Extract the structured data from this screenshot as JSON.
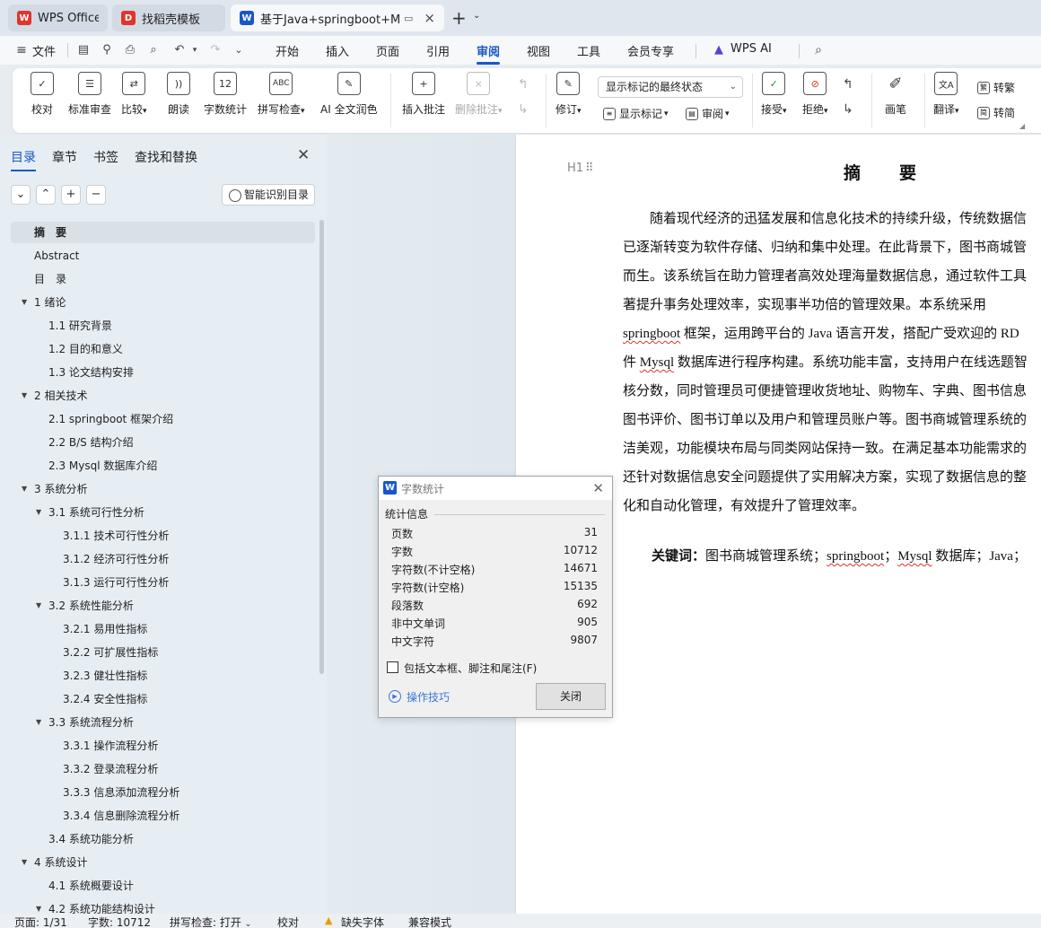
{
  "tabs": [
    {
      "label": "WPS Office",
      "icon": "wps-logo-icon"
    },
    {
      "label": "找稻壳模板",
      "icon": "docer-icon"
    },
    {
      "label": "基于Java+springboot+MyS",
      "icon": "word-doc-icon"
    }
  ],
  "menu": {
    "file": "文件",
    "items": [
      "开始",
      "插入",
      "页面",
      "引用",
      "审阅",
      "视图",
      "工具",
      "会员专享"
    ],
    "selected": "审阅",
    "wps_ai": "WPS AI"
  },
  "ribbon": {
    "proofread": "校对",
    "std_review": "标准审查",
    "compare": "比较",
    "read_aloud": "朗读",
    "word_count": "字数统计",
    "spell_check": "拼写检查",
    "ai_polish": "AI 全文润色",
    "insert_comment": "插入批注",
    "delete_comment": "删除批注",
    "track_changes": "修订",
    "markup_select": "显示标记的最终状态",
    "show_markup": "显示标记",
    "review_pane": "审阅",
    "accept": "接受",
    "reject": "拒绝",
    "pen": "画笔",
    "translate": "翻译",
    "to_traditional": "转繁",
    "to_simplified": "转简"
  },
  "nav": {
    "tabs": [
      "目录",
      "章节",
      "书签",
      "查找和替换"
    ],
    "smart_toc": "智能识别目录",
    "toc": [
      {
        "label": "摘　要",
        "level": 0,
        "arrow": ""
      },
      {
        "label": "Abstract",
        "level": 0,
        "arrow": ""
      },
      {
        "label": "目　录",
        "level": 0,
        "arrow": ""
      },
      {
        "label": "1  绪论",
        "level": 0,
        "arrow": "▼"
      },
      {
        "label": "1.1  研究背景",
        "level": 1,
        "arrow": ""
      },
      {
        "label": "1.2  目的和意义",
        "level": 1,
        "arrow": ""
      },
      {
        "label": "1.3  论文结构安排",
        "level": 1,
        "arrow": ""
      },
      {
        "label": "2  相关技术",
        "level": 0,
        "arrow": "▼"
      },
      {
        "label": "2.1 springboot 框架介绍",
        "level": 1,
        "arrow": ""
      },
      {
        "label": "2.2 B/S 结构介绍",
        "level": 1,
        "arrow": ""
      },
      {
        "label": "2.3 Mysql 数据库介绍",
        "level": 1,
        "arrow": ""
      },
      {
        "label": "3  系统分析",
        "level": 0,
        "arrow": "▼"
      },
      {
        "label": "3.1  系统可行性分析",
        "level": 1,
        "arrow": "▼"
      },
      {
        "label": "3.1.1  技术可行性分析",
        "level": 2,
        "arrow": ""
      },
      {
        "label": "3.1.2  经济可行性分析",
        "level": 2,
        "arrow": ""
      },
      {
        "label": "3.1.3  运行可行性分析",
        "level": 2,
        "arrow": ""
      },
      {
        "label": "3.2  系统性能分析",
        "level": 1,
        "arrow": "▼"
      },
      {
        "label": "3.2.1  易用性指标",
        "level": 2,
        "arrow": ""
      },
      {
        "label": "3.2.2  可扩展性指标",
        "level": 2,
        "arrow": ""
      },
      {
        "label": "3.2.3  健壮性指标",
        "level": 2,
        "arrow": ""
      },
      {
        "label": "3.2.4  安全性指标",
        "level": 2,
        "arrow": ""
      },
      {
        "label": "3.3  系统流程分析",
        "level": 1,
        "arrow": "▼"
      },
      {
        "label": "3.3.1  操作流程分析",
        "level": 2,
        "arrow": ""
      },
      {
        "label": "3.3.2  登录流程分析",
        "level": 2,
        "arrow": ""
      },
      {
        "label": "3.3.3  信息添加流程分析",
        "level": 2,
        "arrow": ""
      },
      {
        "label": "3.3.4  信息删除流程分析",
        "level": 2,
        "arrow": ""
      },
      {
        "label": "3.4  系统功能分析",
        "level": 1,
        "arrow": ""
      },
      {
        "label": "4  系统设计",
        "level": 0,
        "arrow": "▼"
      },
      {
        "label": "4.1  系统概要设计",
        "level": 1,
        "arrow": ""
      },
      {
        "label": "4.2  系统功能结构设计",
        "level": 1,
        "arrow": "▼"
      }
    ]
  },
  "document": {
    "heading_marker": "H1",
    "title": "摘　要",
    "lines": [
      "　　随着现代经济的迅猛发展和信息化技术的持续升级，传统数据信",
      "已逐渐转变为软件存储、归纳和集中处理。在此背景下，图书商城管",
      "而生。该系统旨在助力管理者高效处理海量数据信息，通过软件工具",
      "著提升事务处理效率，实现事半功倍的管理效果。本系统采用",
      "springboot 框架，运用跨平台的 Java 语言开发，搭配广受欢迎的 RD",
      "件 Mysql 数据库进行程序构建。系统功能丰富，支持用户在线选题智",
      "核分数，同时管理员可便捷管理收货地址、购物车、字典、图书信息",
      "图书评价、图书订单以及用户和管理员账户等。图书商城管理系统的",
      "洁美观，功能模块布局与同类网站保持一致。在满足基本功能需求的",
      "还针对数据信息安全问题提供了实用解决方案，实现了数据信息的整",
      "化和自动化管理，有效提升了管理效率。"
    ],
    "keywords_label": "关键词：",
    "keywords": "图书商城管理系统；springboot；Mysql 数据库；Java；"
  },
  "dialog": {
    "title": "字数统计",
    "section": "统计信息",
    "stats": [
      {
        "label": "页数",
        "value": "31"
      },
      {
        "label": "字数",
        "value": "10712"
      },
      {
        "label": "字符数(不计空格)",
        "value": "14671"
      },
      {
        "label": "字符数(计空格)",
        "value": "15135"
      },
      {
        "label": "段落数",
        "value": "692"
      },
      {
        "label": "非中文单词",
        "value": "905"
      },
      {
        "label": "中文字符",
        "value": "9807"
      }
    ],
    "checkbox_label": "包括文本框、脚注和尾注(F)",
    "tips_link": "操作技巧",
    "close_label": "关闭"
  },
  "status": {
    "page": "页面: 1/31",
    "words": "字数: 10712",
    "spell": "拼写检查: 打开",
    "proof": "校对",
    "missing_font": "缺失字体",
    "compat": "兼容模式"
  },
  "colors": {
    "accent": "#1a56c8",
    "wps_red": "#e0342e"
  }
}
